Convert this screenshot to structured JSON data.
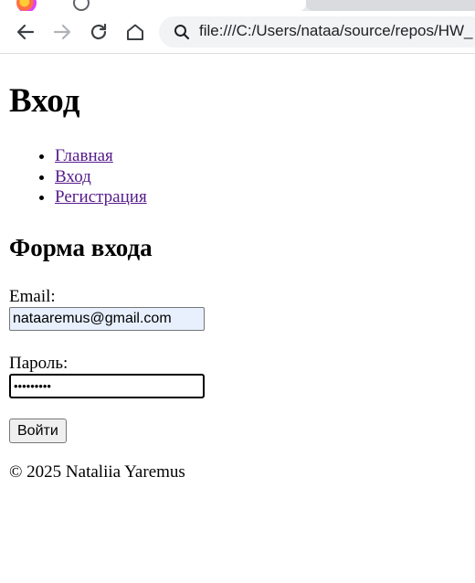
{
  "browser": {
    "url": "file:///C:/Users/nataa/source/repos/HW_",
    "icons": {
      "back": "arrow-left-icon",
      "forward": "arrow-right-icon",
      "reload": "reload-icon",
      "home": "home-icon",
      "search": "search-icon"
    },
    "forward_disabled": true
  },
  "page": {
    "title": "Вход",
    "nav": [
      {
        "label": "Главная"
      },
      {
        "label": "Вход"
      },
      {
        "label": "Регистрация"
      }
    ],
    "form": {
      "heading": "Форма входа",
      "email_label": "Email:",
      "email_value": "nataaremus@gmail.com",
      "password_label": "Пароль:",
      "password_value": "•••••••••",
      "submit_label": "Войти"
    },
    "footer": "© 2025 Nataliia Yaremus"
  },
  "colors": {
    "link": "#551a8b",
    "autofill": "#e8f0fe"
  }
}
